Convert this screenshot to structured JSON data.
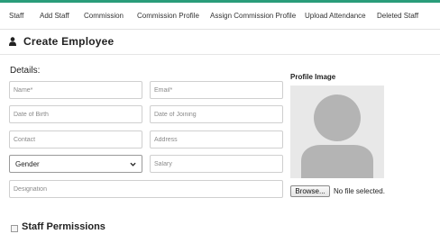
{
  "nav": {
    "items": [
      {
        "label": "Staff"
      },
      {
        "label": "Add Staff"
      },
      {
        "label": "Commission"
      },
      {
        "label": "Commission Profile"
      },
      {
        "label": "Assign Commission Profile"
      },
      {
        "label": "Upload Attendance"
      },
      {
        "label": "Deleted Staff"
      }
    ]
  },
  "header": {
    "title": "Create Employee",
    "icon": "user-icon"
  },
  "form": {
    "section_label": "Details:",
    "fields": {
      "name": {
        "placeholder": "Name*",
        "value": ""
      },
      "email": {
        "placeholder": "Email*",
        "value": ""
      },
      "dob": {
        "placeholder": "Date of Birth",
        "value": ""
      },
      "doj": {
        "placeholder": "Date of Joining",
        "value": ""
      },
      "contact": {
        "placeholder": "Contact",
        "value": ""
      },
      "address": {
        "placeholder": "Address",
        "value": ""
      },
      "gender": {
        "selected": "Gender"
      },
      "salary": {
        "placeholder": "Salary",
        "value": ""
      },
      "designation": {
        "placeholder": "Designation",
        "value": ""
      }
    }
  },
  "profile": {
    "label": "Profile Image",
    "browse_label": "Browse...",
    "file_status": "No file selected."
  },
  "permissions": {
    "label": "Staff Permissions",
    "checked": false
  },
  "colors": {
    "accent": "#2a9d7a",
    "avatar_bg": "#e8e8e8",
    "avatar_fg": "#b4b4b4"
  }
}
